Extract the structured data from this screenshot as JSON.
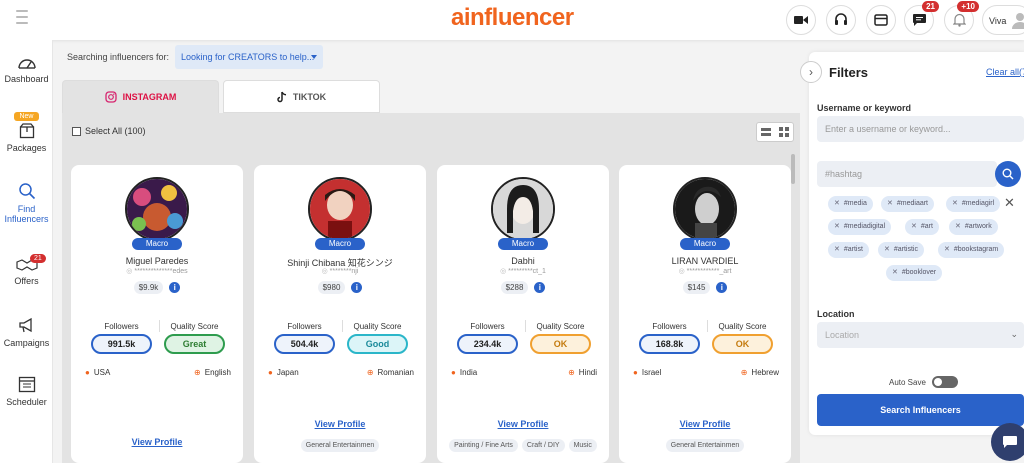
{
  "header": {
    "logo_part1": "ai",
    "logo_part2": "nfluencer",
    "messages_badge": "21",
    "notifications_badge": "+10",
    "user_label": "Viva"
  },
  "sidebar": {
    "items": [
      {
        "label": "Dashboard"
      },
      {
        "label": "Packages",
        "tag": "New"
      },
      {
        "label": "Find Influencers"
      },
      {
        "label": "Offers",
        "badge": "21"
      },
      {
        "label": "Campaigns"
      },
      {
        "label": "Scheduler"
      }
    ]
  },
  "search": {
    "label": "Searching influencers for:",
    "value": "Looking for CREATORS to help..."
  },
  "tabs": [
    {
      "label": "INSTAGRAM"
    },
    {
      "label": "TIKTOK"
    }
  ],
  "select_all": "Select All (100)",
  "cards_meta": {
    "followers_header": "Followers",
    "quality_header": "Quality Score",
    "view_profile": "View Profile"
  },
  "cards": [
    {
      "tier": "Macro",
      "name": "Miguel Paredes",
      "handle": "**************edes",
      "price": "$9.9k",
      "followers": "991.5k",
      "quality": "Great",
      "country": "USA",
      "language": "English",
      "tags": []
    },
    {
      "tier": "Macro",
      "name": "Shinji Chibana 知花シンジ",
      "handle": "********nji",
      "price": "$980",
      "followers": "504.4k",
      "quality": "Good",
      "country": "Japan",
      "language": "Romanian",
      "tags": [
        "General Entertainmen"
      ]
    },
    {
      "tier": "Macro",
      "name": "Dabhi",
      "handle": "*********ct_1",
      "price": "$288",
      "followers": "234.4k",
      "quality": "OK",
      "country": "India",
      "language": "Hindi",
      "tags": [
        "Painting / Fine Arts",
        "Craft / DIY",
        "Music"
      ]
    },
    {
      "tier": "Macro",
      "name": "LIRAN VARDIEL",
      "handle": "************_art",
      "price": "$145",
      "followers": "168.8k",
      "quality": "OK",
      "country": "Israel",
      "language": "Hebrew",
      "tags": [
        "General Entertainmen"
      ]
    }
  ],
  "filters": {
    "title": "Filters",
    "clear_all": "Clear all(7",
    "username_label": "Username or keyword",
    "username_placeholder": "Enter a username or keyword...",
    "hashtag_placeholder": "#hashtag",
    "hashtags": [
      "#media",
      "#mediaart",
      "#mediagirl",
      "#mediadigital",
      "#art",
      "#artwork",
      "#artist",
      "#artistic",
      "#bookstagram",
      "#booklover"
    ],
    "location_label": "Location",
    "location_placeholder": "Location",
    "auto_save": "Auto Save",
    "search_button": "Search Influencers"
  },
  "colors": {
    "brand_orange": "#f0641e",
    "primary_blue": "#2a62c9",
    "quality_great": "#2e9c4e",
    "quality_good": "#2bb6c9",
    "quality_ok": "#f0a030"
  }
}
